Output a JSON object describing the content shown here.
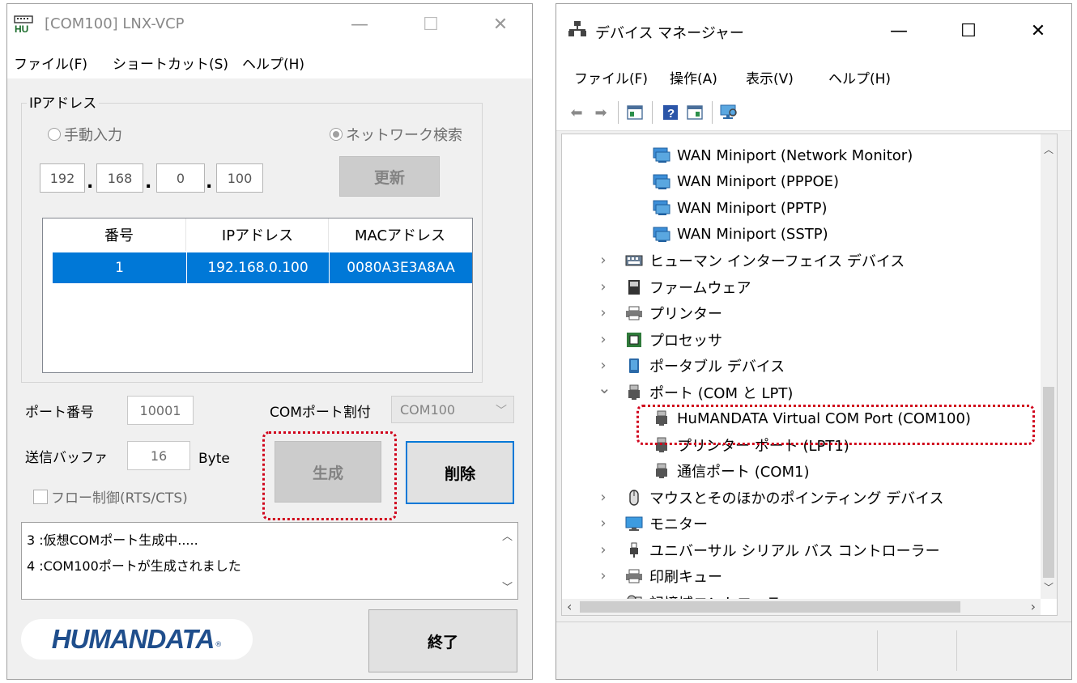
{
  "lnx_window": {
    "title": "[COM100] LNX-VCP",
    "controls": {
      "minimize": "—",
      "maximize": "☐",
      "close": "✕"
    },
    "menu": [
      "ファイル(F)",
      "ショートカット(S)",
      "ヘルプ(H)"
    ],
    "ip_group": {
      "label": "IPアドレス",
      "manual_radio": "手動入力",
      "network_radio": "ネットワーク検索",
      "ip_octets": [
        "192",
        "168",
        "0",
        "100"
      ],
      "refresh_button": "更新"
    },
    "device_table": {
      "columns": [
        "番号",
        "IPアドレス",
        "MACアドレス"
      ],
      "rows": [
        [
          "1",
          "192.168.0.100",
          "0080A3E3A8AA"
        ]
      ]
    },
    "port_label": "ポート番号",
    "port_value": "10001",
    "com_assign_label": "COMポート割付",
    "com_assign_value": "COM100",
    "send_buffer_label": "送信バッファ",
    "send_buffer_value": "16",
    "send_buffer_unit": "Byte",
    "flow_control_label": "フロー制御(RTS/CTS)",
    "create_button": "生成",
    "delete_button": "削除",
    "log_lines": [
      "3 :仮想COMポート生成中.....",
      "4 :COM100ポートが生成されました"
    ],
    "logo_text": "HUMANDATA",
    "exit_button": "終了",
    "accent_color": "#0078d7",
    "highlight_color": "#d0021b"
  },
  "devmgr_window": {
    "title": "デバイス マネージャー",
    "controls": {
      "minimize": "—",
      "maximize": "☐",
      "close": "✕"
    },
    "menu": [
      "ファイル(F)",
      "操作(A)",
      "表示(V)",
      "ヘルプ(H)"
    ],
    "tree": [
      {
        "label": "WAN Miniport (Network Monitor)",
        "icon": "network-adapter-icon",
        "level": 2
      },
      {
        "label": "WAN Miniport (PPPOE)",
        "icon": "network-adapter-icon",
        "level": 2
      },
      {
        "label": "WAN Miniport (PPTP)",
        "icon": "network-adapter-icon",
        "level": 2
      },
      {
        "label": "WAN Miniport (SSTP)",
        "icon": "network-adapter-icon",
        "level": 2
      },
      {
        "label": "ヒューマン インターフェイス デバイス",
        "icon": "hid-icon",
        "level": 1,
        "chevron": "›"
      },
      {
        "label": "ファームウェア",
        "icon": "firmware-icon",
        "level": 1,
        "chevron": "›"
      },
      {
        "label": "プリンター",
        "icon": "printer-icon",
        "level": 1,
        "chevron": "›"
      },
      {
        "label": "プロセッサ",
        "icon": "processor-icon",
        "level": 1,
        "chevron": "›"
      },
      {
        "label": "ポータブル デバイス",
        "icon": "portable-device-icon",
        "level": 1,
        "chevron": "›"
      },
      {
        "label": "ポート (COM と LPT)",
        "icon": "port-icon",
        "level": 1,
        "chevron": "⌄"
      },
      {
        "label": "HuMANDATA Virtual COM Port (COM100)",
        "icon": "port-icon",
        "level": 2
      },
      {
        "label": "プリンター ポート (LPT1)",
        "icon": "port-icon",
        "level": 2
      },
      {
        "label": "通信ポート (COM1)",
        "icon": "port-icon",
        "level": 2
      },
      {
        "label": "マウスとそのほかのポインティング デバイス",
        "icon": "mouse-icon",
        "level": 1,
        "chevron": "›"
      },
      {
        "label": "モニター",
        "icon": "monitor-icon",
        "level": 1,
        "chevron": "›"
      },
      {
        "label": "ユニバーサル シリアル バス コントローラー",
        "icon": "usb-icon",
        "level": 1,
        "chevron": "›"
      },
      {
        "label": "印刷キュー",
        "icon": "printer-icon",
        "level": 1,
        "chevron": "›"
      },
      {
        "label": "記憶域コントローラー",
        "icon": "storage-icon",
        "level": 1,
        "chevron": "›"
      }
    ]
  }
}
